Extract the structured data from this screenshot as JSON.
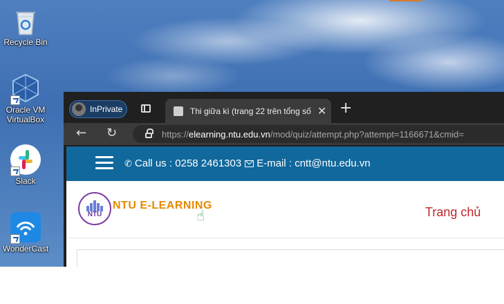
{
  "desktop": {
    "icons": [
      {
        "label": "Recycle Bin",
        "icon": "recycle-bin-icon"
      },
      {
        "label": "Oracle VM VirtualBox",
        "line1": "Oracle VM",
        "line2": "VirtualBox",
        "icon": "virtualbox-icon"
      },
      {
        "label": "Slack",
        "icon": "slack-icon"
      },
      {
        "label": "WonderCast",
        "icon": "wondercast-icon"
      }
    ]
  },
  "browser": {
    "profile_label": "InPrivate",
    "tab_title": "Thi giữa kì (trang 22 trên tổng số",
    "close_glyph": "✕",
    "new_tab_glyph": "+",
    "url_prefix": "https://",
    "url_host": "elearning.ntu.edu.vn",
    "url_path": "/mod/quiz/attempt.php?attempt=1166671&cmid=",
    "back_glyph": "←",
    "refresh_glyph": "↻"
  },
  "site": {
    "contact": {
      "phone_label": "Call us : 0258 2461303",
      "email_label": "E-mail : cntt@ntu.edu.vn"
    },
    "logo_text": "NTU",
    "brand": "NTU E-LEARNING",
    "nav_home": "Trang chủ"
  },
  "colors": {
    "topbar": "#10689c",
    "brand": "#e58a00",
    "nav_home": "#c0262b"
  }
}
